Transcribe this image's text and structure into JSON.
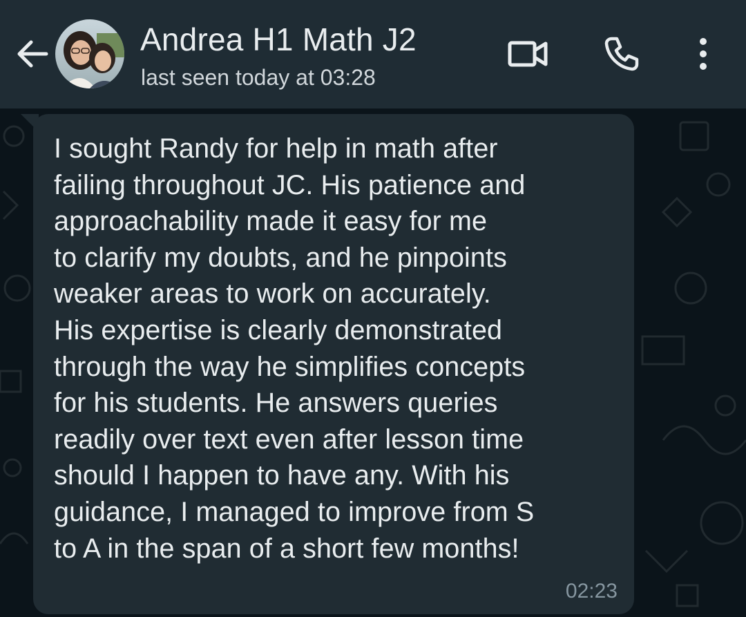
{
  "header": {
    "back_icon": "arrow-left-icon",
    "contact_name": "Andrea H1 Math J2",
    "status": "last seen today at 03:28",
    "actions": [
      {
        "icon": "video-camera-icon"
      },
      {
        "icon": "phone-icon"
      },
      {
        "icon": "more-vertical-icon"
      }
    ]
  },
  "message": {
    "text": "I sought Randy for help in math after\nfailing throughout JC. His patience and\napproachability made it easy for me\nto clarify my doubts, and he pinpoints\nweaker areas to work on accurately.\nHis expertise is clearly demonstrated\nthrough the way he simplifies concepts\nfor his students. He answers queries\nreadily over text even after lesson time\nshould I happen to have any. With his\nguidance, I managed to improve from S\nto A in the span of a short few months!",
    "time": "02:23"
  },
  "colors": {
    "header_bg": "#1f2c34",
    "chat_bg": "#0b141a",
    "bubble_bg": "#202c33",
    "text_primary": "#e9edef",
    "text_secondary": "#8696a0"
  }
}
